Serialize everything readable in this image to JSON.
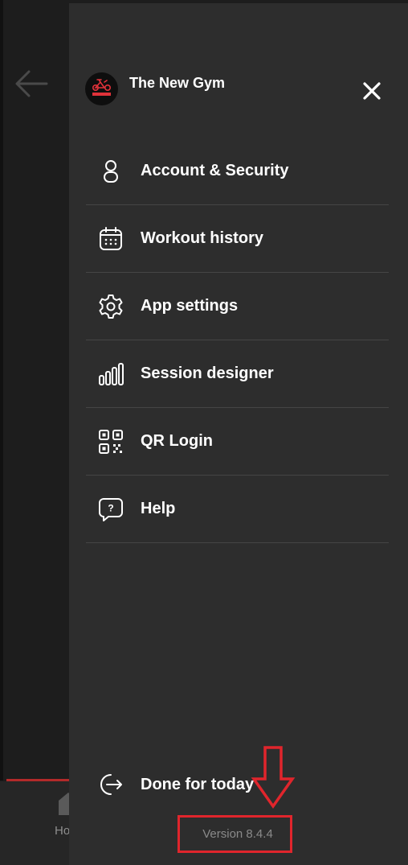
{
  "background": {
    "home_tab_label": "Ho"
  },
  "drawer": {
    "brand": {
      "logo_text": "THE NEW GYM",
      "name": "The New Gym"
    },
    "menu": [
      {
        "label": "Account & Security",
        "icon": "person-icon"
      },
      {
        "label": "Workout history",
        "icon": "calendar-icon"
      },
      {
        "label": "App settings",
        "icon": "gear-icon"
      },
      {
        "label": "Session designer",
        "icon": "bars-icon"
      },
      {
        "label": "QR Login",
        "icon": "qr-code-icon"
      },
      {
        "label": "Help",
        "icon": "help-bubble-icon"
      }
    ],
    "done_label": "Done for today",
    "version": "Version 8.4.4"
  },
  "colors": {
    "drawer_bg": "#2d2d2d",
    "accent_red": "#e0252c",
    "text_primary": "#ffffff",
    "text_muted": "#8a8a8a",
    "divider": "#454545"
  }
}
